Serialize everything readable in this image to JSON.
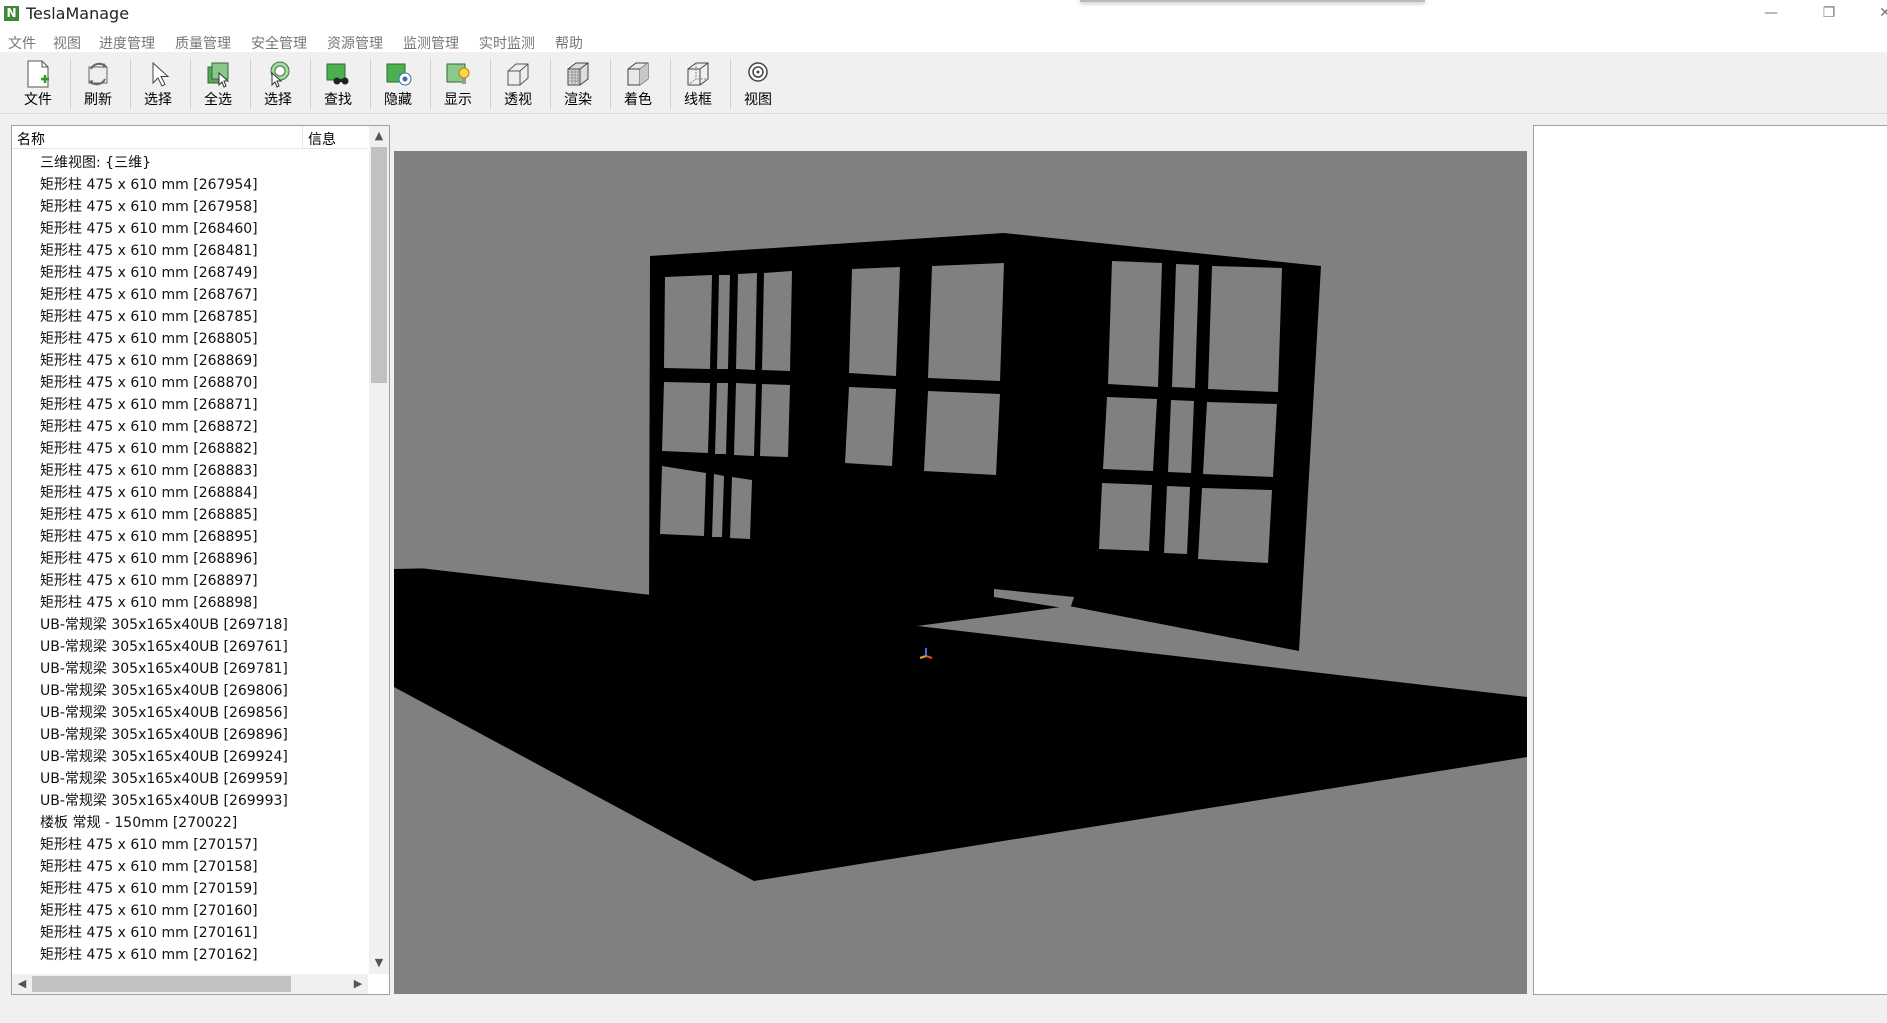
{
  "window": {
    "title": "TeslaManage",
    "logo_letter": "N",
    "minimize": "—",
    "maximize": "❐",
    "close": "✕"
  },
  "menu": [
    "文件",
    "视图",
    "进度管理",
    "质量管理",
    "安全管理",
    "资源管理",
    "监测管理",
    "实时监测",
    "帮助"
  ],
  "toolbar": [
    {
      "label": "文件",
      "icon": "new-file-icon"
    },
    {
      "label": "刷新",
      "icon": "refresh-icon"
    },
    {
      "label": "选择",
      "icon": "cursor-icon"
    },
    {
      "label": "全选",
      "icon": "select-all-icon"
    },
    {
      "label": "选择",
      "icon": "select-icon"
    },
    {
      "label": "查找",
      "icon": "find-icon"
    },
    {
      "label": "隐藏",
      "icon": "hide-icon"
    },
    {
      "label": "显示",
      "icon": "show-icon"
    },
    {
      "label": "透视",
      "icon": "perspective-icon"
    },
    {
      "label": "渲染",
      "icon": "render-icon"
    },
    {
      "label": "着色",
      "icon": "shading-icon"
    },
    {
      "label": "线框",
      "icon": "wireframe-icon"
    },
    {
      "label": "视图",
      "icon": "view-icon"
    }
  ],
  "tree": {
    "col_name": "名称",
    "col_info": "信息",
    "items": [
      "三维视图: {三维}",
      "矩形柱 475 x 610 mm [267954]",
      "矩形柱 475 x 610 mm [267958]",
      "矩形柱 475 x 610 mm [268460]",
      "矩形柱 475 x 610 mm [268481]",
      "矩形柱 475 x 610 mm [268749]",
      "矩形柱 475 x 610 mm [268767]",
      "矩形柱 475 x 610 mm [268785]",
      "矩形柱 475 x 610 mm [268805]",
      "矩形柱 475 x 610 mm [268869]",
      "矩形柱 475 x 610 mm [268870]",
      "矩形柱 475 x 610 mm [268871]",
      "矩形柱 475 x 610 mm [268872]",
      "矩形柱 475 x 610 mm [268882]",
      "矩形柱 475 x 610 mm [268883]",
      "矩形柱 475 x 610 mm [268884]",
      "矩形柱 475 x 610 mm [268885]",
      "矩形柱 475 x 610 mm [268895]",
      "矩形柱 475 x 610 mm [268896]",
      "矩形柱 475 x 610 mm [268897]",
      "矩形柱 475 x 610 mm [268898]",
      "UB-常规梁 305x165x40UB [269718]",
      "UB-常规梁 305x165x40UB [269761]",
      "UB-常规梁 305x165x40UB [269781]",
      "UB-常规梁 305x165x40UB [269806]",
      "UB-常规梁 305x165x40UB [269856]",
      "UB-常规梁 305x165x40UB [269896]",
      "UB-常规梁 305x165x40UB [269924]",
      "UB-常规梁 305x165x40UB [269959]",
      "UB-常规梁 305x165x40UB [269993]",
      "楼板 常规 - 150mm [270022]",
      "矩形柱 475 x 610 mm [270157]",
      "矩形柱 475 x 610 mm [270158]",
      "矩形柱 475 x 610 mm [270159]",
      "矩形柱 475 x 610 mm [270160]",
      "矩形柱 475 x 610 mm [270161]",
      "矩形柱 475 x 610 mm [270162]"
    ]
  },
  "viewport": {
    "background": "#808080",
    "model_color": "#000000"
  }
}
